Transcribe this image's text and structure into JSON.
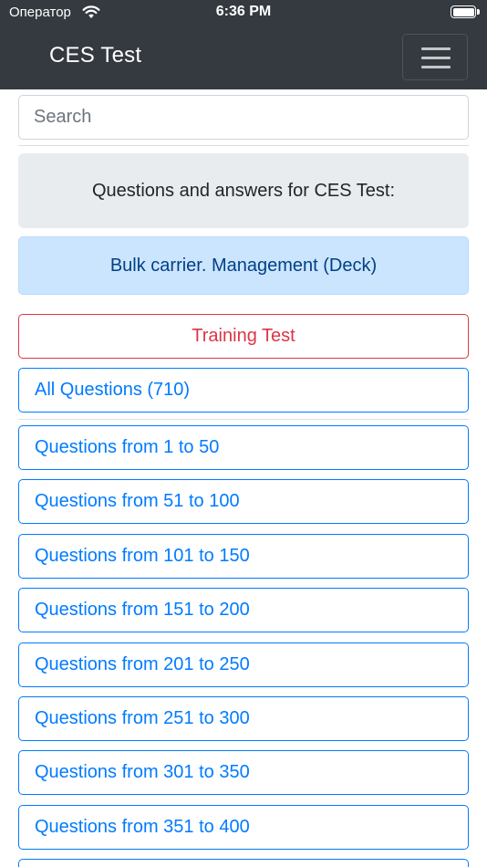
{
  "statusbar": {
    "carrier": "Оператор",
    "time": "6:36 PM"
  },
  "navbar": {
    "brand": "CES Test",
    "menu_icon": "hamburger-menu-icon"
  },
  "search": {
    "placeholder": "Search"
  },
  "header": {
    "text": "Questions and answers for CES Test:"
  },
  "category": {
    "label": "Bulk carrier. Management (Deck)"
  },
  "training": {
    "label": "Training Test"
  },
  "all_questions": {
    "label": "All Questions (710)"
  },
  "ranges": [
    "Questions from 1 to 50",
    "Questions from 51 to 100",
    "Questions from 101 to 150",
    "Questions from 151 to 200",
    "Questions from 201 to 250",
    "Questions from 251 to 300",
    "Questions from 301 to 350",
    "Questions from 351 to 400"
  ],
  "colors": {
    "navbar": "#343a40",
    "primary": "#007bff",
    "danger": "#dc3545",
    "info_bg": "#cce5ff",
    "jumbotron_bg": "#e9ecef"
  }
}
